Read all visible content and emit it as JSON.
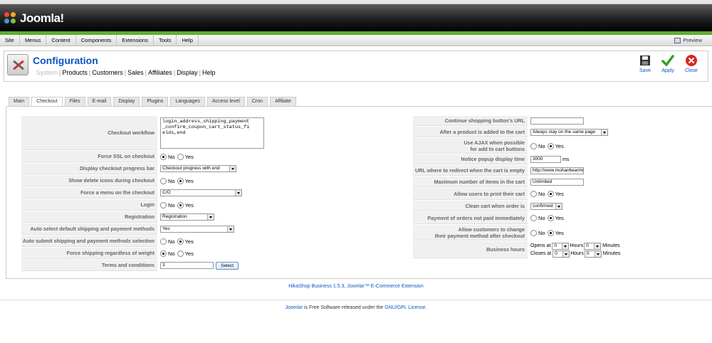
{
  "app": {
    "logo_text": "Joomla!"
  },
  "menubar": {
    "items": [
      "Site",
      "Menus",
      "Content",
      "Components",
      "Extensions",
      "Tools",
      "Help"
    ],
    "preview": "Preview"
  },
  "toolbar": {
    "title": "Configuration",
    "subnav": [
      "System",
      "Products",
      "Customers",
      "Sales",
      "Affiliates",
      "Display",
      "Help"
    ],
    "save": "Save",
    "apply": "Apply",
    "close": "Close"
  },
  "tabs": [
    "Main",
    "Checkout",
    "Files",
    "E-mail",
    "Display",
    "Plugins",
    "Languages",
    "Access level",
    "Cron",
    "Affiliate"
  ],
  "radio": {
    "no": "No",
    "yes": "Yes"
  },
  "left": {
    "checkout_workflow": {
      "label": "Checkout workflow",
      "value": "login_address_shipping_payment\n_confirm_coupon_cart_status_fi\nelds,end"
    },
    "force_ssl": {
      "label": "Force SSL on checkout",
      "selected": "No"
    },
    "progress_bar": {
      "label": "Display checkout progress bar",
      "value": "Checkout progress with end"
    },
    "delete_icons": {
      "label": "Show delete icons during checkout",
      "selected": "Yes"
    },
    "force_menu": {
      "label": "Force a menu on the checkout",
      "value": "C/O"
    },
    "login": {
      "label": "Login",
      "selected": "Yes"
    },
    "registration": {
      "label": "Registration",
      "value": "Registration"
    },
    "auto_select": {
      "label": "Auto select default shipping and payment methods",
      "value": "Yes"
    },
    "auto_submit": {
      "label": "Auto submit shipping and payment methods selection",
      "selected": "Yes"
    },
    "force_shipping": {
      "label": "Force shipping regardless of weight",
      "selected": "No"
    },
    "terms": {
      "label": "Terms and conditions",
      "value": "3",
      "button": "Select"
    }
  },
  "right": {
    "continue_url": {
      "label": "Continue shopping button's URL",
      "value": ""
    },
    "after_add": {
      "label": "After a product is added to the cart",
      "value": "Always stay on the same page"
    },
    "use_ajax": {
      "label_line1": "Use AJAX when possible",
      "label_line2": "for add to cart buttons",
      "selected": "Yes"
    },
    "notice_popup": {
      "label": "Notice popup display time",
      "value": "3000",
      "unit": "ms"
    },
    "redirect_empty": {
      "label": "URL where to redirect when the cart is empty",
      "value": "http://www.mohairbearmi"
    },
    "max_items": {
      "label": "Maximum number of items in the cart",
      "value": "Unlimited"
    },
    "print_cart": {
      "label": "Allow users to print their cart",
      "selected": "Yes"
    },
    "clean_cart": {
      "label": "Clean cart when order is",
      "value": "confirmed"
    },
    "payment_not_paid": {
      "label": "Payment of orders not paid immediately",
      "selected": "Yes"
    },
    "change_payment": {
      "label_line1": "Allow customers to change",
      "label_line2": "their payment method after checkout",
      "selected": "Yes"
    },
    "business_hours": {
      "label": "Business hours",
      "opens_label": "Opens at",
      "closes_label": "Closes at",
      "hours_label": "Hours",
      "minutes_label": "Minutes",
      "opens_hour": "0",
      "opens_minute": "0",
      "closes_hour": "0",
      "closes_minute": "0"
    }
  },
  "footer": {
    "hikashop": "HikaShop Business 1.5.3, Joomla!™ E-Commerce Extension",
    "joomla_link": "Joomla!",
    "joomla_text": " is Free Software released under the ",
    "license_link": "GNU/GPL License",
    "period": "."
  },
  "colors": {
    "accent": "#0b55c4",
    "header_green": "#5dae2e"
  }
}
